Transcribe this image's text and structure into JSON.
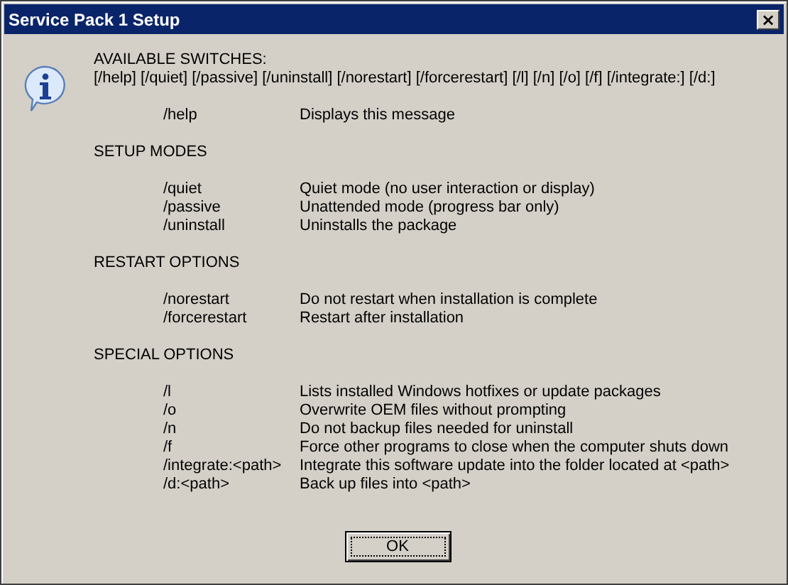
{
  "window": {
    "title": "Service Pack 1 Setup",
    "close_label": "×"
  },
  "intro": {
    "heading": "AVAILABLE SWITCHES:",
    "switches": "[/help] [/quiet] [/passive] [/uninstall] [/norestart] [/forcerestart] [/l] [/n] [/o] [/f] [/integrate:] [/d:]"
  },
  "sections": [
    {
      "options": [
        {
          "switch": "/help",
          "description": "Displays this message"
        }
      ]
    },
    {
      "heading": "SETUP MODES",
      "options": [
        {
          "switch": "/quiet",
          "description": "Quiet mode (no user interaction or display)"
        },
        {
          "switch": "/passive",
          "description": "Unattended mode (progress bar only)"
        },
        {
          "switch": "/uninstall",
          "description": "Uninstalls the package"
        }
      ]
    },
    {
      "heading": "RESTART OPTIONS",
      "options": [
        {
          "switch": "/norestart",
          "description": "Do not restart when installation is complete"
        },
        {
          "switch": "/forcerestart",
          "description": "Restart after installation"
        }
      ]
    },
    {
      "heading": "SPECIAL OPTIONS",
      "options": [
        {
          "switch": "/l",
          "description": "Lists installed Windows hotfixes or update packages"
        },
        {
          "switch": "/o",
          "description": "Overwrite OEM files without prompting"
        },
        {
          "switch": "/n",
          "description": "Do not backup files needed for uninstall"
        },
        {
          "switch": "/f",
          "description": "Force other programs to close when the computer shuts down"
        },
        {
          "switch": "/integrate:<path>",
          "description": "Integrate this software update into the folder located at <path>"
        },
        {
          "switch": "/d:<path>",
          "description": "Back up files into <path>"
        }
      ]
    }
  ],
  "buttons": [
    "OK"
  ]
}
